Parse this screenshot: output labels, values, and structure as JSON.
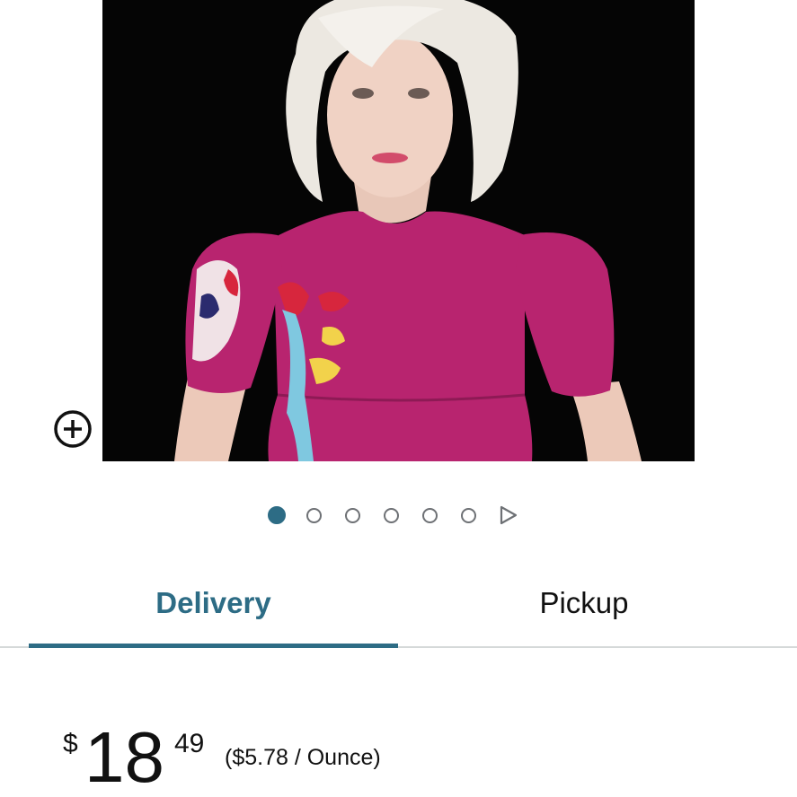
{
  "product_image": {
    "alt": "Woman with platinum blonde layered wig wearing a magenta puff-sleeve top"
  },
  "icons": {
    "zoom": "zoom-in-icon",
    "next": "play-triangle-icon"
  },
  "carousel": {
    "total_dots": 6,
    "active_index": 0
  },
  "tabs": {
    "delivery": "Delivery",
    "pickup": "Pickup",
    "active": "delivery"
  },
  "price": {
    "currency": "$",
    "whole": "18",
    "fraction": "49",
    "unit_price": "($5.78 / Ounce)"
  },
  "colors": {
    "accent": "#2d6c85",
    "divider": "#d5d9d9",
    "text": "#111111"
  }
}
